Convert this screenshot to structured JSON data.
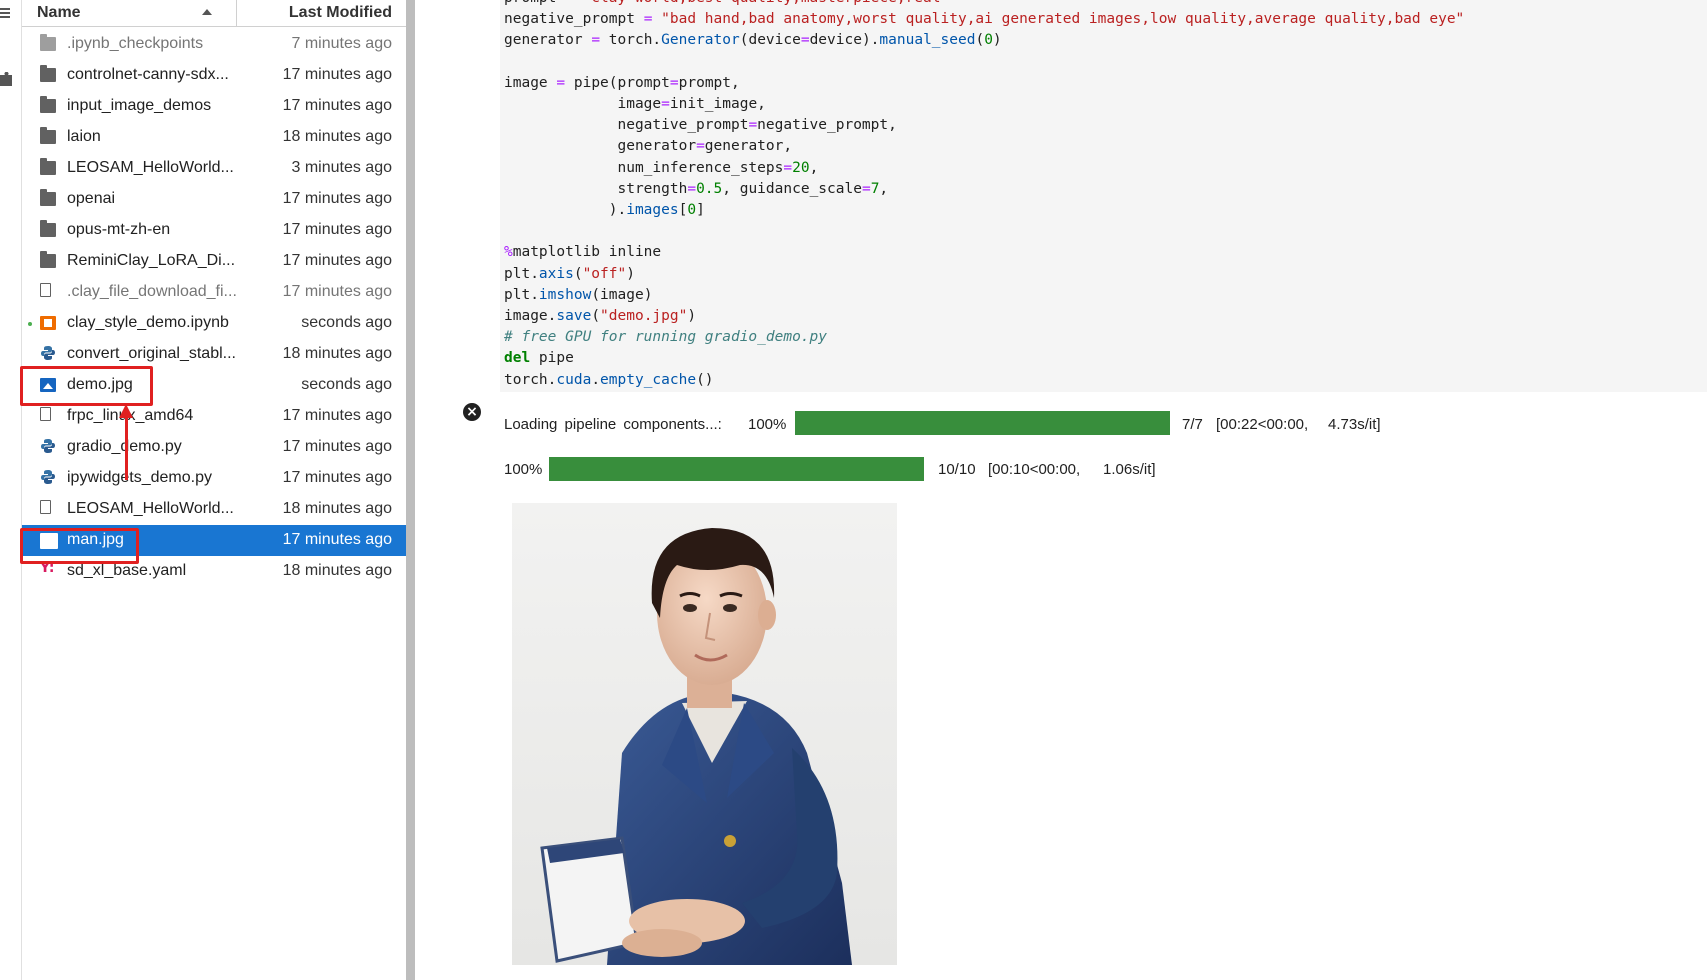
{
  "browser": {
    "header": {
      "name": "Name",
      "last_modified": "Last Modified"
    },
    "files": [
      {
        "name": ".ipynb_checkpoints",
        "modified": "7 minutes ago",
        "kind": "folder",
        "dim": true
      },
      {
        "name": "controlnet-canny-sdx...",
        "modified": "17 minutes ago",
        "kind": "folder"
      },
      {
        "name": "input_image_demos",
        "modified": "17 minutes ago",
        "kind": "folder"
      },
      {
        "name": "laion",
        "modified": "18 minutes ago",
        "kind": "folder"
      },
      {
        "name": "LEOSAM_HelloWorld...",
        "modified": "3 minutes ago",
        "kind": "folder"
      },
      {
        "name": "openai",
        "modified": "17 minutes ago",
        "kind": "folder"
      },
      {
        "name": "opus-mt-zh-en",
        "modified": "17 minutes ago",
        "kind": "folder"
      },
      {
        "name": "ReminiClay_LoRA_Di...",
        "modified": "17 minutes ago",
        "kind": "folder"
      },
      {
        "name": ".clay_file_download_fi...",
        "modified": "17 minutes ago",
        "kind": "file",
        "dim": true
      },
      {
        "name": "clay_style_demo.ipynb",
        "modified": "seconds ago",
        "kind": "notebook",
        "running": true
      },
      {
        "name": "convert_original_stabl...",
        "modified": "18 minutes ago",
        "kind": "python"
      },
      {
        "name": "demo.jpg",
        "modified": "seconds ago",
        "kind": "image"
      },
      {
        "name": "frpc_linux_amd64",
        "modified": "17 minutes ago",
        "kind": "file"
      },
      {
        "name": "gradio_demo.py",
        "modified": "17 minutes ago",
        "kind": "python"
      },
      {
        "name": "ipywidgets_demo.py",
        "modified": "17 minutes ago",
        "kind": "python"
      },
      {
        "name": "LEOSAM_HelloWorld...",
        "modified": "18 minutes ago",
        "kind": "file"
      },
      {
        "name": "man.jpg",
        "modified": "17 minutes ago",
        "kind": "image",
        "selected": true
      },
      {
        "name": "sd_xl_base.yaml",
        "modified": "18 minutes ago",
        "kind": "yaml"
      }
    ]
  },
  "code": {
    "lines": [
      "prompt = \"clay world,best quality,masterpiece,real\"",
      "negative_prompt = \"bad hand,bad anatomy,worst quality,ai generated images,low quality,average quality,bad eye\"",
      "generator = torch.Generator(device=device).manual_seed(0)",
      "",
      "image = pipe(prompt=prompt,",
      "             image=init_image,",
      "             negative_prompt=negative_prompt,",
      "             generator=generator,",
      "             num_inference_steps=20,",
      "             strength=0.5, guidance_scale=7,",
      "            ).images[0]",
      "",
      "%matplotlib inline",
      "plt.axis(\"off\")",
      "plt.imshow(image)",
      "image.save(\"demo.jpg\")",
      "# free GPU for running gradio_demo.py",
      "del pipe",
      "torch.cuda.empty_cache()"
    ]
  },
  "output": {
    "progress1": {
      "label": "Loading pipeline components...:",
      "percent_text": "100%",
      "value": 1.0,
      "count": "7/7",
      "timing": "[00:22<00:00,",
      "rate": "4.73s/it]"
    },
    "progress2": {
      "percent_text": "100%",
      "value": 1.0,
      "count": "10/10",
      "timing": "[00:10<00:00,",
      "rate": "1.06s/it]"
    }
  },
  "colors": {
    "selection": "#1976d2",
    "progress": "#388e3c",
    "annotation": "#e02020"
  }
}
